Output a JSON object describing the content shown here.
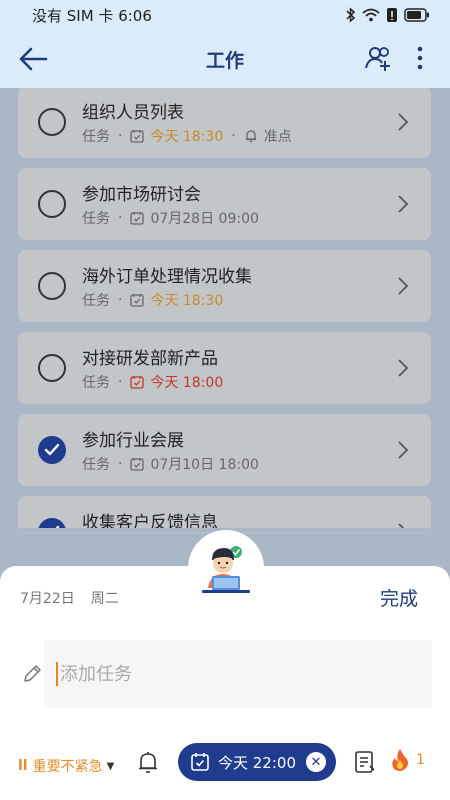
{
  "status_bar": {
    "carrier_time": "没有 SIM 卡 6:06"
  },
  "header": {
    "title": "工作"
  },
  "tasks": [
    {
      "title": "组织人员列表",
      "type": "任务",
      "time": "今天 18:30",
      "reminder": "准点",
      "done": false,
      "time_color": "orange"
    },
    {
      "title": "参加市场研讨会",
      "type": "任务",
      "time": "07月28日 09:00",
      "reminder": "",
      "done": false,
      "time_color": "gray"
    },
    {
      "title": "海外订单处理情况收集",
      "type": "任务",
      "time": "今天 18:30",
      "reminder": "",
      "done": false,
      "time_color": "orange"
    },
    {
      "title": "对接研发部新产品",
      "type": "任务",
      "time": "今天 18:00",
      "reminder": "",
      "done": false,
      "time_color": "red"
    },
    {
      "title": "参加行业会展",
      "type": "任务",
      "time": "07月10日 18:00",
      "reminder": "",
      "done": true,
      "time_color": "gray"
    },
    {
      "title": "收集客户反馈信息",
      "type": "",
      "time": "",
      "reminder": "",
      "done": true,
      "time_color": "gray"
    }
  ],
  "sheet": {
    "date": "7月22日",
    "weekday": "周二",
    "done_label": "完成",
    "input_placeholder": "添加任务",
    "priority_label": "重要不紧急",
    "date_pill": "今天 22:00",
    "streak_count": "1"
  },
  "colors": {
    "accent": "#1f3c8f",
    "header_bg": "#dcebfa",
    "orange": "#c9892a",
    "red": "#c0392b"
  }
}
